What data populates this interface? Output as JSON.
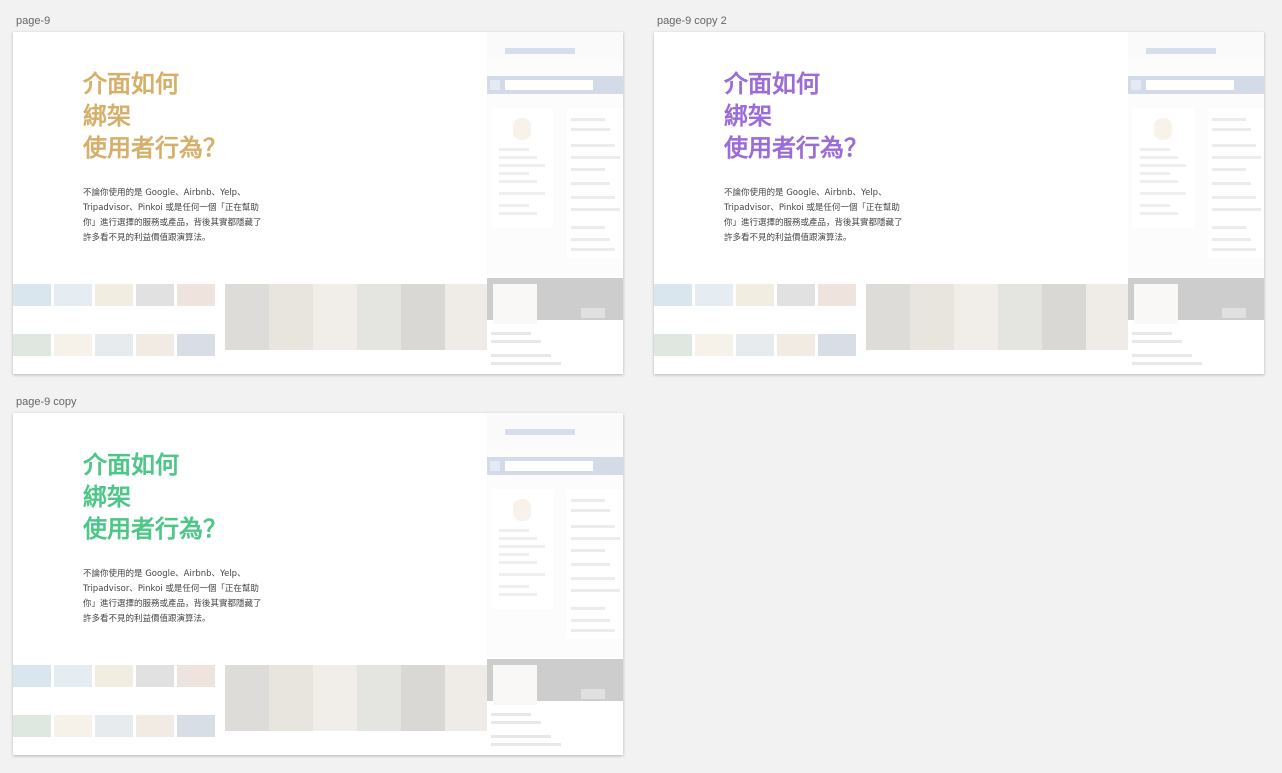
{
  "canvas_background": "#f2f2f2",
  "artboards": [
    {
      "name": "page-9",
      "accent_color": "#d6b06a"
    },
    {
      "name": "page-9 copy 2",
      "accent_color": "#9b6bd8"
    },
    {
      "name": "page-9 copy",
      "accent_color": "#4cc787"
    }
  ],
  "content": {
    "headline_lines": [
      "介面如何",
      "綁架",
      "使用者行為？"
    ],
    "body_lines": [
      "不論你使用的是 Google、Airbnb、Yelp、",
      "Tripadvisor、Pinkoi 或是任何一個「正在幫助",
      "你」進行選擇的服務或產品，背後其實都隱藏了",
      "許多看不見的利益價值跟演算法。"
    ],
    "body_color": "#444444"
  }
}
